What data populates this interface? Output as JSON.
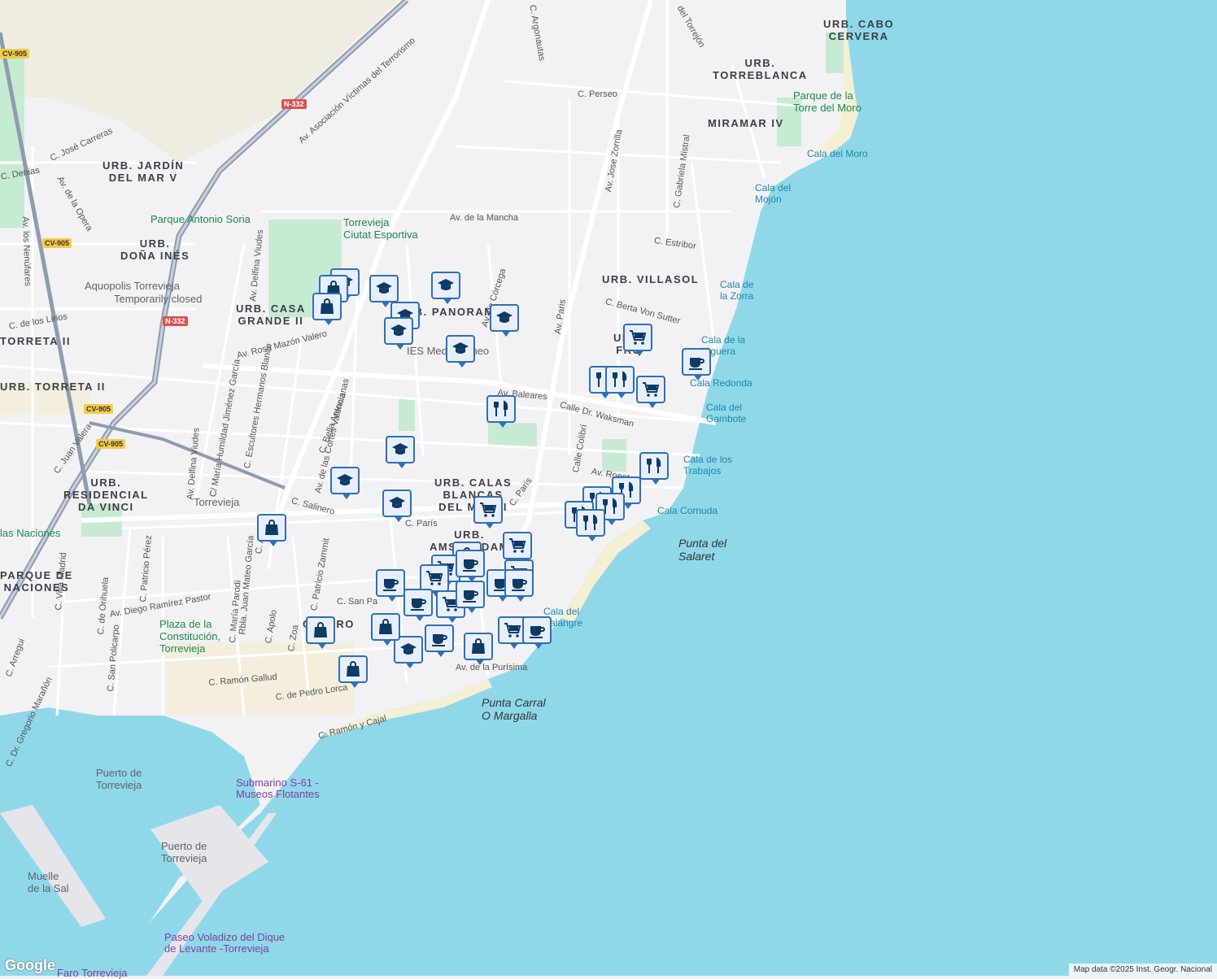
{
  "colors": {
    "sea": "#8fd8ea",
    "land": "#f2f2f4",
    "park": "#c6ebd2",
    "beach": "#f5efd3",
    "road": "#ffffff",
    "highway": "#8e9bb0",
    "pin_border": "#2f6fb5",
    "pin_fill": "#e8effb",
    "pin_icon": "#0d3b66"
  },
  "areas": [
    {
      "text": "URB. CABO\nCERVERA"
    },
    {
      "text": "URB.\nTORREBLANCA"
    },
    {
      "text": "MIRAMAR IV"
    },
    {
      "text": "URB. JARDÍN\nDEL MAR V"
    },
    {
      "text": "URB.\nDOÑA INÉS"
    },
    {
      "text": "URB. CASA\nGRANDE II"
    },
    {
      "text": "URB. VILLASOL"
    },
    {
      "text": "URB. PANORAMA"
    },
    {
      "text": "URB.\nFRU"
    },
    {
      "text": "TORRETA II"
    },
    {
      "text": "URB. TORRETA II"
    },
    {
      "text": "URB.\nRESIDENCIAL\nDA VINCI"
    },
    {
      "text": "URB. CALAS\nBLANCAS\nDEL MAR II"
    },
    {
      "text": "URB.\nAMSTERDAM"
    },
    {
      "text": "PARQUE DE\nNACIONES"
    },
    {
      "text": "CENTRO"
    }
  ],
  "water_labels": [
    {
      "text": "Cala del Moro"
    },
    {
      "text": "Cala del\nMojón"
    },
    {
      "text": "Cala de\nla Zorra"
    },
    {
      "text": "Cala de la\nHiguera"
    },
    {
      "text": "Cala Redonda"
    },
    {
      "text": "Cala del\nGambote"
    },
    {
      "text": "Cala de los\nTrabajos"
    },
    {
      "text": "Cala Cornuda"
    },
    {
      "text": "Cala del\nPalangre"
    }
  ],
  "headlands": [
    {
      "text": "Punta del\nSalaret"
    },
    {
      "text": "Punta Carral\nO Margalla"
    }
  ],
  "pois_green": [
    {
      "text": "Parque de la\nTorre del Moro"
    },
    {
      "text": "Parque Antonio Soria"
    },
    {
      "text": "Torrevieja\nCiutat Esportiva"
    },
    {
      "text": "Plaza de la\nConstitución,\nTorrevieja"
    },
    {
      "text": "las Naciones"
    }
  ],
  "pois_gray": [
    {
      "text": "Aquopolis Torrevieja"
    },
    {
      "text": "Temporarily closed"
    },
    {
      "text": "IES Mediterráneo"
    },
    {
      "text": "Torrevieja"
    },
    {
      "text": "Puerto de\nTorrevieja"
    },
    {
      "text": "Puerto de\nTorrevieja"
    },
    {
      "text": "Muelle\nde la Sal"
    }
  ],
  "pois_purple": [
    {
      "text": "Submarino S-61 -\nMuseos Flotantes"
    },
    {
      "text": "Paseo Voladizo del Dique\nde Levante -Torrevieja"
    },
    {
      "text": "Faro Torrevieja"
    }
  ],
  "streets": [
    {
      "text": "C. Perseo"
    },
    {
      "text": "Av. Jose Zorrilla"
    },
    {
      "text": "C. Gabriela Mistral"
    },
    {
      "text": "C. Estribor"
    },
    {
      "text": "Av. de la Mancha"
    },
    {
      "text": "Av. Asociación Víctimas del Terrorismo"
    },
    {
      "text": "C. José Carreras"
    },
    {
      "text": "Av. de la Opera"
    },
    {
      "text": "Av. los Nenúfares"
    },
    {
      "text": "Av. Delfina Viudes"
    },
    {
      "text": "Av. Rosa Mazón Valero"
    },
    {
      "text": "Av. de las Cortes Valencianas"
    },
    {
      "text": "Av. Baleares"
    },
    {
      "text": "Calle Dr. Waksman"
    },
    {
      "text": "C. Berta Von Sutter"
    },
    {
      "text": "Av. Paris"
    },
    {
      "text": "Av. de Córcega"
    },
    {
      "text": "C. Argonautas"
    },
    {
      "text": "del Torrejón"
    },
    {
      "text": "C. Salinero"
    },
    {
      "text": "C. París"
    },
    {
      "text": "C. París"
    },
    {
      "text": "Calle Colibrí"
    },
    {
      "text": "Av. Roent"
    },
    {
      "text": "C. Bella Antonia"
    },
    {
      "text": "C. Escultores Hermanos Blanco"
    },
    {
      "text": "C/ María Humildad Jiménez García"
    },
    {
      "text": "Av. Diego Ramírez Pastor"
    },
    {
      "text": "C. San Policarpo"
    },
    {
      "text": "C. de Orihuela"
    },
    {
      "text": "C. Patricio Pérez"
    },
    {
      "text": "C. Villa Madrid"
    },
    {
      "text": "C. Apolo"
    },
    {
      "text": "C. Apolo"
    },
    {
      "text": "Rbla. Juan Mateo García"
    },
    {
      "text": "C. María Parodi"
    },
    {
      "text": "C. Patricio Zammit"
    },
    {
      "text": "C. Zoa"
    },
    {
      "text": "C. Ramón Gallud"
    },
    {
      "text": "C. de Pedro Lorca"
    },
    {
      "text": "C. Ramón y Cajal"
    },
    {
      "text": "Av. de la Purísima"
    },
    {
      "text": "C. San Pa"
    },
    {
      "text": "C. Juan Valera"
    },
    {
      "text": "Av. Delfina Viudes"
    },
    {
      "text": "C. Dr. Gregorio Marañón"
    },
    {
      "text": "C. Arregui"
    },
    {
      "text": "C. Denias"
    },
    {
      "text": "C. de los Lirios"
    }
  ],
  "shields": [
    {
      "text": "CV-905",
      "style": "yellow"
    },
    {
      "text": "CV-905",
      "style": "yellow"
    },
    {
      "text": "CV-905",
      "style": "yellow"
    },
    {
      "text": "CV-905",
      "style": "yellow"
    },
    {
      "text": "N-332",
      "style": "red"
    },
    {
      "text": "N-332",
      "style": "red"
    }
  ],
  "pins": [
    {
      "icon": "school"
    },
    {
      "icon": "school"
    },
    {
      "icon": "school"
    },
    {
      "icon": "school"
    },
    {
      "icon": "school"
    },
    {
      "icon": "school"
    },
    {
      "icon": "school"
    },
    {
      "icon": "school"
    },
    {
      "icon": "school"
    },
    {
      "icon": "school"
    },
    {
      "icon": "school"
    },
    {
      "icon": "shop"
    },
    {
      "icon": "shop"
    },
    {
      "icon": "shop"
    },
    {
      "icon": "shop"
    },
    {
      "icon": "shop"
    },
    {
      "icon": "shop"
    },
    {
      "icon": "shop"
    },
    {
      "icon": "shop"
    },
    {
      "icon": "cart"
    },
    {
      "icon": "cart"
    },
    {
      "icon": "cart"
    },
    {
      "icon": "cart"
    },
    {
      "icon": "cart"
    },
    {
      "icon": "cart"
    },
    {
      "icon": "cart"
    },
    {
      "icon": "cart"
    },
    {
      "icon": "cart"
    },
    {
      "icon": "restaurant"
    },
    {
      "icon": "restaurant"
    },
    {
      "icon": "restaurant"
    },
    {
      "icon": "restaurant"
    },
    {
      "icon": "restaurant"
    },
    {
      "icon": "restaurant"
    },
    {
      "icon": "restaurant"
    },
    {
      "icon": "restaurant"
    },
    {
      "icon": "restaurant"
    },
    {
      "icon": "cafe"
    },
    {
      "icon": "cafe"
    },
    {
      "icon": "cafe"
    },
    {
      "icon": "cafe"
    },
    {
      "icon": "cafe"
    },
    {
      "icon": "cafe"
    },
    {
      "icon": "cafe"
    },
    {
      "icon": "cafe"
    },
    {
      "icon": "cafe"
    }
  ],
  "attribution": "Map data ©2025 Inst. Geogr. Nacional",
  "google_logo": "Google"
}
